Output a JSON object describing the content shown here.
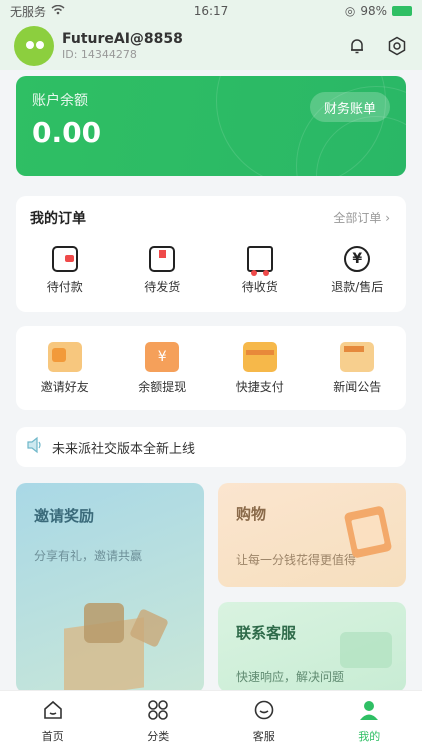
{
  "status_bar": {
    "carrier": "无服务",
    "time": "16:17",
    "battery": "98%"
  },
  "header": {
    "username": "FutureAI@8858",
    "user_id": "ID: 14344278",
    "icons": [
      "bell-icon",
      "settings-icon"
    ]
  },
  "balance": {
    "label": "账户余额",
    "amount": "0.00",
    "button": "财务账单"
  },
  "orders": {
    "title": "我的订单",
    "all_label": "全部订单",
    "items": [
      {
        "label": "待付款",
        "icon": "wallet-icon"
      },
      {
        "label": "待发货",
        "icon": "package-icon"
      },
      {
        "label": "待收货",
        "icon": "truck-icon"
      },
      {
        "label": "退款/售后",
        "icon": "refund-icon"
      }
    ]
  },
  "services": {
    "items": [
      {
        "label": "邀请好友",
        "icon": "gift-icon"
      },
      {
        "label": "余额提现",
        "icon": "cash-icon"
      },
      {
        "label": "快捷支付",
        "icon": "card-icon"
      },
      {
        "label": "新闻公告",
        "icon": "news-icon"
      }
    ]
  },
  "notice": {
    "text": "未来派社交版本全新上线"
  },
  "promos": {
    "invite": {
      "title": "邀请奖励",
      "subtitle": "分享有礼，邀请共赢"
    },
    "shop": {
      "title": "购物",
      "subtitle": "让每一分钱花得更值得"
    },
    "support": {
      "title": "联系客服",
      "subtitle": "快速响应，解决问题"
    }
  },
  "tabbar": {
    "items": [
      {
        "label": "首页",
        "icon": "home-icon"
      },
      {
        "label": "分类",
        "icon": "grid-icon"
      },
      {
        "label": "客服",
        "icon": "chat-icon"
      },
      {
        "label": "我的",
        "icon": "user-icon"
      }
    ],
    "active": "我的"
  },
  "colors": {
    "accent": "#2fbf64",
    "orange": "#f5a623"
  }
}
